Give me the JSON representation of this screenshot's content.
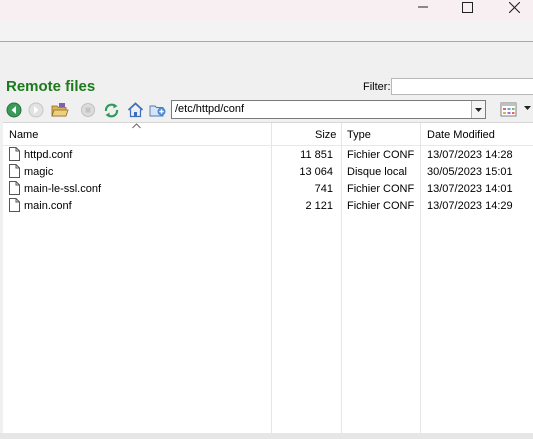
{
  "window": {
    "controls": {
      "minimize": "—",
      "maximize": "☐",
      "close": "✕"
    }
  },
  "panel": {
    "title": "Remote files",
    "filter_label": "Filter:",
    "filter_value": "",
    "path": "/etc/httpd/conf"
  },
  "columns": {
    "name": "Name",
    "size": "Size",
    "type": "Type",
    "date": "Date Modified"
  },
  "files": [
    {
      "name": "httpd.conf",
      "size": "11 851",
      "type": "Fichier CONF",
      "date": "13/07/2023 14:28"
    },
    {
      "name": "magic",
      "size": "13 064",
      "type": "Disque local",
      "date": "30/05/2023 15:01"
    },
    {
      "name": "main-le-ssl.conf",
      "size": "741",
      "type": "Fichier CONF",
      "date": "13/07/2023 14:01"
    },
    {
      "name": "main.conf",
      "size": "2 121",
      "type": "Fichier CONF",
      "date": "13/07/2023 14:29"
    }
  ],
  "icons": {
    "back": "arrow-left-circle-icon",
    "forward": "arrow-right-circle-icon",
    "open_folder": "open-folder-icon",
    "stop": "stop-icon",
    "refresh": "refresh-icon",
    "home": "home-icon",
    "new_folder": "new-folder-icon",
    "view": "view-options-icon",
    "file": "document-icon"
  },
  "colors": {
    "title_green": "#1c7a1c",
    "back_button": "#3a9a58"
  }
}
